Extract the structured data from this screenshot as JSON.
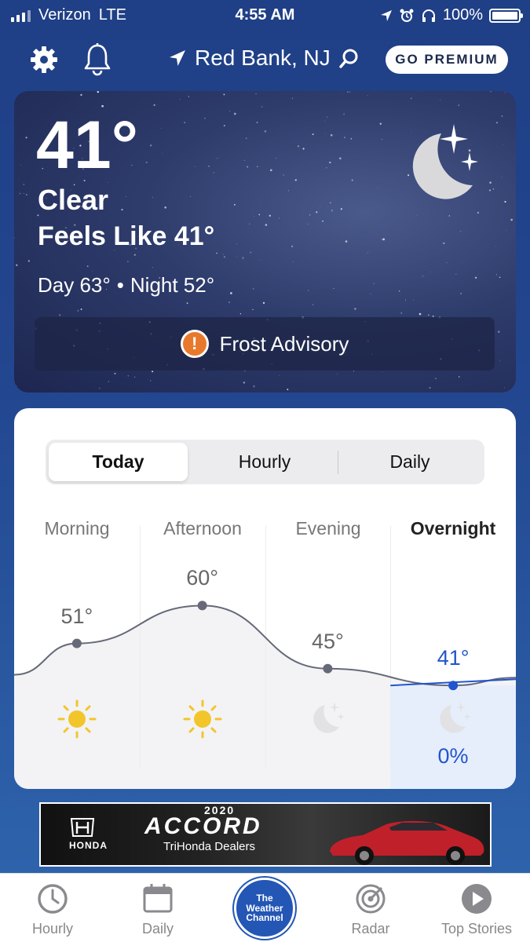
{
  "status_bar": {
    "carrier": "Verizon",
    "network": "LTE",
    "time": "4:55 AM",
    "battery": "100%"
  },
  "header": {
    "location": "Red Bank, NJ",
    "premium_label": "GO PREMIUM"
  },
  "current": {
    "temperature": "41°",
    "condition": "Clear",
    "feels_like": "Feels Like 41°",
    "day": "Day 63°",
    "separator": "•",
    "night": "Night 52°",
    "alert": "Frost Advisory",
    "alert_icon": "!",
    "condition_icon": "moon-stars-icon"
  },
  "forecast": {
    "tabs": [
      {
        "label": "Today",
        "active": true
      },
      {
        "label": "Hourly",
        "active": false
      },
      {
        "label": "Daily",
        "active": false
      }
    ],
    "periods": [
      {
        "label": "Morning",
        "temp": 51,
        "temp_label": "51°",
        "icon": "sun-icon",
        "active": false
      },
      {
        "label": "Afternoon",
        "temp": 60,
        "temp_label": "60°",
        "icon": "sun-icon",
        "active": false
      },
      {
        "label": "Evening",
        "temp": 45,
        "temp_label": "45°",
        "icon": "moon-icon",
        "active": false
      },
      {
        "label": "Overnight",
        "temp": 41,
        "temp_label": "41°",
        "icon": "moon-icon",
        "active": true,
        "precip": "0%"
      }
    ],
    "colors": {
      "active": "#2255cc",
      "curve": "#666a78",
      "sun": "#f2c52b"
    }
  },
  "ad": {
    "brand": "HONDA",
    "year": "2020",
    "model": "ACCORD",
    "dealer": "TriHonda Dealers"
  },
  "tabbar": {
    "items": [
      {
        "label": "Hourly",
        "icon": "clock-icon"
      },
      {
        "label": "Daily",
        "icon": "calendar-icon"
      },
      {
        "label": "The Weather Channel",
        "icon": "twc-logo"
      },
      {
        "label": "Radar",
        "icon": "radar-icon"
      },
      {
        "label": "Top Stories",
        "icon": "play-icon"
      }
    ],
    "logo_lines": [
      "The",
      "Weather",
      "Channel"
    ]
  }
}
